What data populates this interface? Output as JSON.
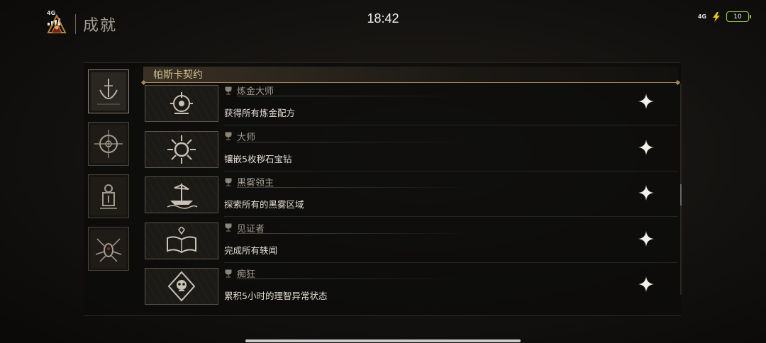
{
  "status_bar": {
    "time": "18:42",
    "network_left": "4G",
    "network_right": "4G",
    "battery": "10",
    "battery_color": "#9ad24c"
  },
  "header": {
    "title": "成就",
    "logo_icon": "game-emblem-icon",
    "back_icon": "back-arrow-icon"
  },
  "tabs": [
    {
      "icon": "anchor-emblem-icon",
      "active": true
    },
    {
      "icon": "compass-sigil-icon",
      "active": false
    },
    {
      "icon": "lantern-emblem-icon",
      "active": false
    },
    {
      "icon": "spider-sigil-icon",
      "active": false
    }
  ],
  "category": {
    "title": "帕斯卡契约"
  },
  "achievements": [
    {
      "name": "炼金大师",
      "desc": "获得所有炼金配方",
      "icon": "alchemy-flask-icon"
    },
    {
      "name": "大师",
      "desc": "镶嵌5枚秽石宝钻",
      "icon": "sun-gem-icon"
    },
    {
      "name": "黑雾领主",
      "desc": "探索所有的黑雾区域",
      "icon": "ship-icon"
    },
    {
      "name": "见证者",
      "desc": "完成所有轶闻",
      "icon": "open-book-icon"
    },
    {
      "name": "痴狂",
      "desc": "累积5小时的理智异常状态",
      "icon": "skull-sigil-icon"
    }
  ],
  "colors": {
    "accent_gold": "#a58a55",
    "text_main": "#e2ddd3",
    "text_muted": "#a49d90"
  }
}
